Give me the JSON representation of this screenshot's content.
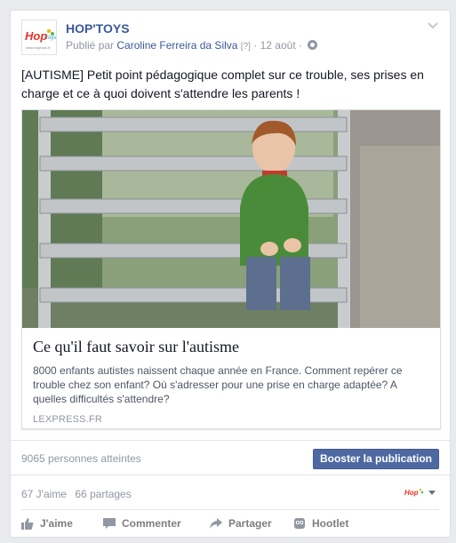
{
  "post": {
    "page_name": "HOP'TOYS",
    "published_prefix": "Publié par",
    "author": "Caroline Ferreira da Silva",
    "help_mark": "[?]",
    "separator": "·",
    "date": "12 août",
    "privacy_icon": "globe-icon",
    "message": "[AUTISME] Petit point pédagogique complet sur ce trouble, ses prises en charge et ce à quoi doivent s'attendre les parents !"
  },
  "logo": {
    "text_hop": "Hop",
    "text_toys": "Toys",
    "url_text": "www.hoptoys.fr",
    "colors": {
      "red": "#e8332a",
      "blue": "#2a8fd4",
      "yellow": "#f4b400",
      "green": "#57b947"
    }
  },
  "link": {
    "title": "Ce qu'il faut savoir sur l'autisme",
    "description": "8000 enfants autistes naissent chaque année en France. Comment repérer ce trouble chez son enfant? Où s'adresser pour une prise en charge adaptée? A quelles difficultés s'attendre?",
    "domain": "LEXPRESS.FR"
  },
  "insights": {
    "reach": "9065 personnes atteintes",
    "boost_label": "Booster la publication"
  },
  "stats": {
    "likes": "67 J'aime",
    "shares": "66 partages"
  },
  "actions": {
    "like": "J'aime",
    "comment": "Commenter",
    "share": "Partager",
    "hootlet": "Hootlet"
  },
  "colors": {
    "link_blue": "#3b5998",
    "boost_bg": "#4e69a2",
    "muted": "#9197a3"
  }
}
